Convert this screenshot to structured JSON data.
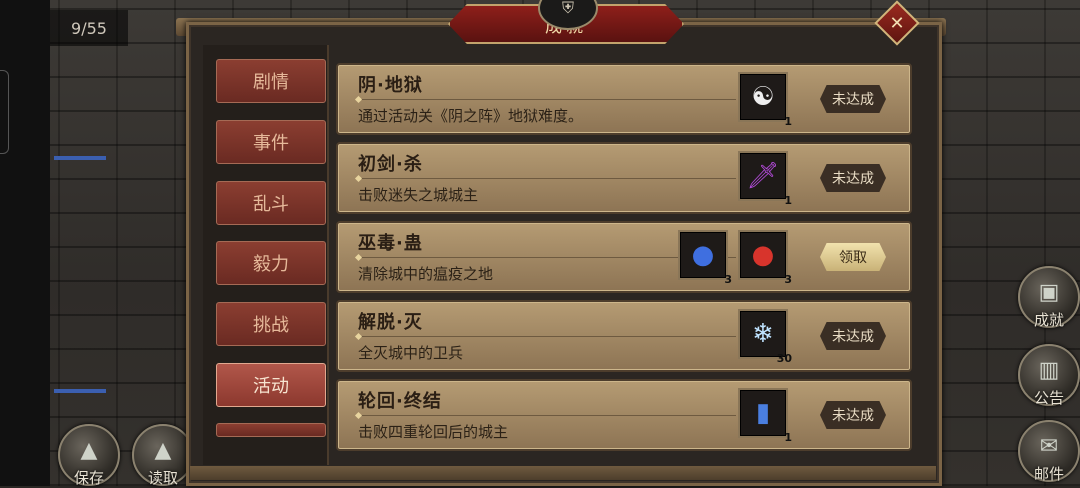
{
  "hud": {
    "counter": "9/55",
    "save_label": "保存",
    "load_label": "读取",
    "achievements_label": "成就",
    "notice_label": "公告",
    "mail_label": "邮件"
  },
  "panel": {
    "title": "成就",
    "close_icon": "close-icon"
  },
  "tabs": [
    {
      "label": "剧情",
      "active": false
    },
    {
      "label": "事件",
      "active": false
    },
    {
      "label": "乱斗",
      "active": false
    },
    {
      "label": "毅力",
      "active": false
    },
    {
      "label": "挑战",
      "active": false
    },
    {
      "label": "活动",
      "active": true
    }
  ],
  "achievements": [
    {
      "name": "阴·地狱",
      "desc": "通过活动关《阴之阵》地狱难度。",
      "rewards": [
        {
          "icon": "yin-yang-token-icon",
          "qty": "1"
        }
      ],
      "status": "未达成"
    },
    {
      "name": "初剑·杀",
      "desc": "击败迷失之城城主",
      "rewards": [
        {
          "icon": "purple-sword-icon",
          "qty": "1"
        }
      ],
      "status": "未达成"
    },
    {
      "name": "巫毒·蛊",
      "desc": "清除城中的瘟疫之地",
      "rewards": [
        {
          "icon": "blue-berries-icon",
          "qty": "3"
        },
        {
          "icon": "red-berries-icon",
          "qty": "3"
        }
      ],
      "status": "领取"
    },
    {
      "name": "解脱·灭",
      "desc": "全灭城中的卫兵",
      "rewards": [
        {
          "icon": "ice-crystal-icon",
          "qty": "30"
        }
      ],
      "status": "未达成"
    },
    {
      "name": "轮回·终结",
      "desc": "击败四重轮回后的城主",
      "rewards": [
        {
          "icon": "blue-scroll-icon",
          "qty": "1"
        }
      ],
      "status": "未达成"
    }
  ]
}
